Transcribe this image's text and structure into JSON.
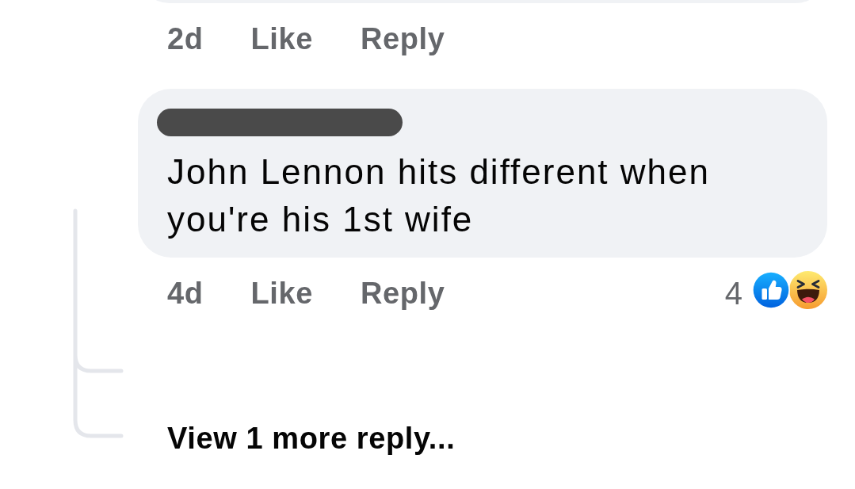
{
  "comments": [
    {
      "kind": "cut_off",
      "time": "2d",
      "actions": [
        "Like",
        "Reply"
      ]
    },
    {
      "kind": "full",
      "author_redacted": true,
      "text": "John Lennon hits different when you're his 1st wife",
      "time": "4d",
      "actions": [
        "Like",
        "Reply"
      ],
      "reaction_count": "4",
      "reactions": [
        {
          "kind": "like"
        },
        {
          "kind": "haha"
        }
      ]
    }
  ],
  "view_more": "View 1 more reply..."
}
